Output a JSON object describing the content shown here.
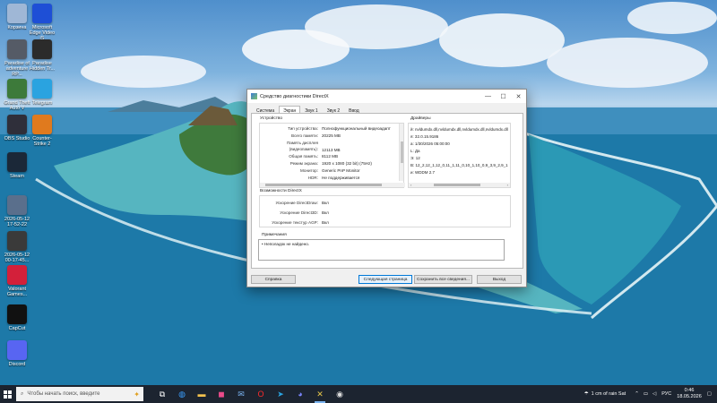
{
  "desktop": {
    "icons": [
      {
        "label": "Корзина",
        "icon": "recycle-bin-icon",
        "color": "#9fb7d6"
      },
      {
        "label": "Microsoft Edge Video iS",
        "icon": "edge-icon",
        "color": "#1e4fd6"
      },
      {
        "label": "Paradise of adventure RP...",
        "icon": "game-icon",
        "color": "#555b66"
      },
      {
        "label": "Paradise Hidden Tr...",
        "icon": "game-icon",
        "color": "#2b2b2b"
      },
      {
        "label": "Grand Theft Auto V",
        "icon": "gta-icon",
        "color": "#3d7a3a"
      },
      {
        "label": "Telegram",
        "icon": "telegram-icon",
        "color": "#2aa3e0"
      },
      {
        "label": "OBS Studio",
        "icon": "obs-icon",
        "color": "#2f2f3a"
      },
      {
        "label": "Counter-Strike 2",
        "icon": "cs2-icon",
        "color": "#e07a1e"
      },
      {
        "label": "Steam",
        "icon": "steam-icon",
        "color": "#1b2838"
      },
      {
        "label": "2026-05-12 17-52-22",
        "icon": "video-file-icon",
        "color": "#5a6f8c"
      },
      {
        "label": "2026-05-12 00-17-45...",
        "icon": "video-file-icon",
        "color": "#3a3a3a"
      },
      {
        "label": "Valorant Games...",
        "icon": "valorant-icon",
        "color": "#d3203a"
      },
      {
        "label": "CapCut",
        "icon": "capcut-icon",
        "color": "#111111"
      },
      {
        "label": "Discord",
        "icon": "discord-icon",
        "color": "#5865f2"
      }
    ]
  },
  "window": {
    "title": "Средство диагностики DirectX",
    "minimize": "—",
    "maximize": "☐",
    "close": "✕",
    "tabs": [
      {
        "label": "Система",
        "active": false
      },
      {
        "label": "Экран",
        "active": true
      },
      {
        "label": "Звук 1",
        "active": false
      },
      {
        "label": "Звук 2",
        "active": false
      },
      {
        "label": "Ввод",
        "active": false
      }
    ],
    "device": {
      "title": "Устройство",
      "rows": [
        {
          "key": "Тип устройства:",
          "value": "Полнофункциональный видеоадапт"
        },
        {
          "key": "Всего памяти:",
          "value": "20225 MB"
        },
        {
          "key": "Память дисплея (видеопамять):",
          "value": "12113 MB"
        },
        {
          "key": "Общая память:",
          "value": "8112 MB"
        },
        {
          "key": "Режим экрана:",
          "value": "1920 x 1080 (32 bit) (75Hz)"
        },
        {
          "key": "Монитор:",
          "value": "Generic PnP Monitor"
        },
        {
          "key": "HDR:",
          "value": "Не поддерживается"
        }
      ]
    },
    "drivers": {
      "title": "Драйверы",
      "rows": [
        "й: nvldumdx.dll,nvldumdx.dll,nvldumdx.dll,nvldumdx.dll",
        "я: 32.0.15.9186",
        "а: 1/30/2026 05:00:00",
        "L: Да",
        "Э: 12",
        "В: 12_2,12_1,12_0,11_1,11_0,10_1,10_0,9_3,9_2,9_1",
        "и: WDDM 2.7"
      ]
    },
    "features": {
      "title": "Возможности DirectX",
      "rows": [
        {
          "key": "Ускорение DirectDraw:",
          "value": "Вкл"
        },
        {
          "key": "Ускорение Direct3D:",
          "value": "Вкл"
        },
        {
          "key": "Ускорение текстур AGP:",
          "value": "Вкл"
        }
      ]
    },
    "notes": {
      "title": "Примечания",
      "items": [
        "Неполадок не найдено."
      ]
    },
    "buttons": {
      "help": "Справка",
      "next": "Следующая страница",
      "save": "Сохранить все сведения...",
      "exit": "Выход"
    }
  },
  "taskbar": {
    "search_placeholder": "Чтобы начать поиск, введите",
    "weather": "1 cm of rain Sat",
    "language": "РУС",
    "time": "0:46",
    "date": "18.05.2026",
    "apps": [
      {
        "icon": "task-view-icon",
        "glyph": "⧉",
        "color": "#ffffff"
      },
      {
        "icon": "edge-icon",
        "glyph": "◍",
        "color": "#3aa0ff"
      },
      {
        "icon": "file-explorer-icon",
        "glyph": "▬",
        "color": "#f2c14e"
      },
      {
        "icon": "store-icon",
        "glyph": "◼",
        "color": "#e94b8a"
      },
      {
        "icon": "mail-icon",
        "glyph": "✉",
        "color": "#7ab3f0"
      },
      {
        "icon": "opera-icon",
        "glyph": "O",
        "color": "#ff2b2b"
      },
      {
        "icon": "telegram-icon",
        "glyph": "➤",
        "color": "#2aa3e0"
      },
      {
        "icon": "discord-icon",
        "glyph": "◕",
        "color": "#7b86ff"
      },
      {
        "icon": "dxdiag-icon",
        "glyph": "✕",
        "color": "#e8c84a"
      },
      {
        "icon": "obs-icon",
        "glyph": "◉",
        "color": "#dddddd"
      }
    ]
  }
}
